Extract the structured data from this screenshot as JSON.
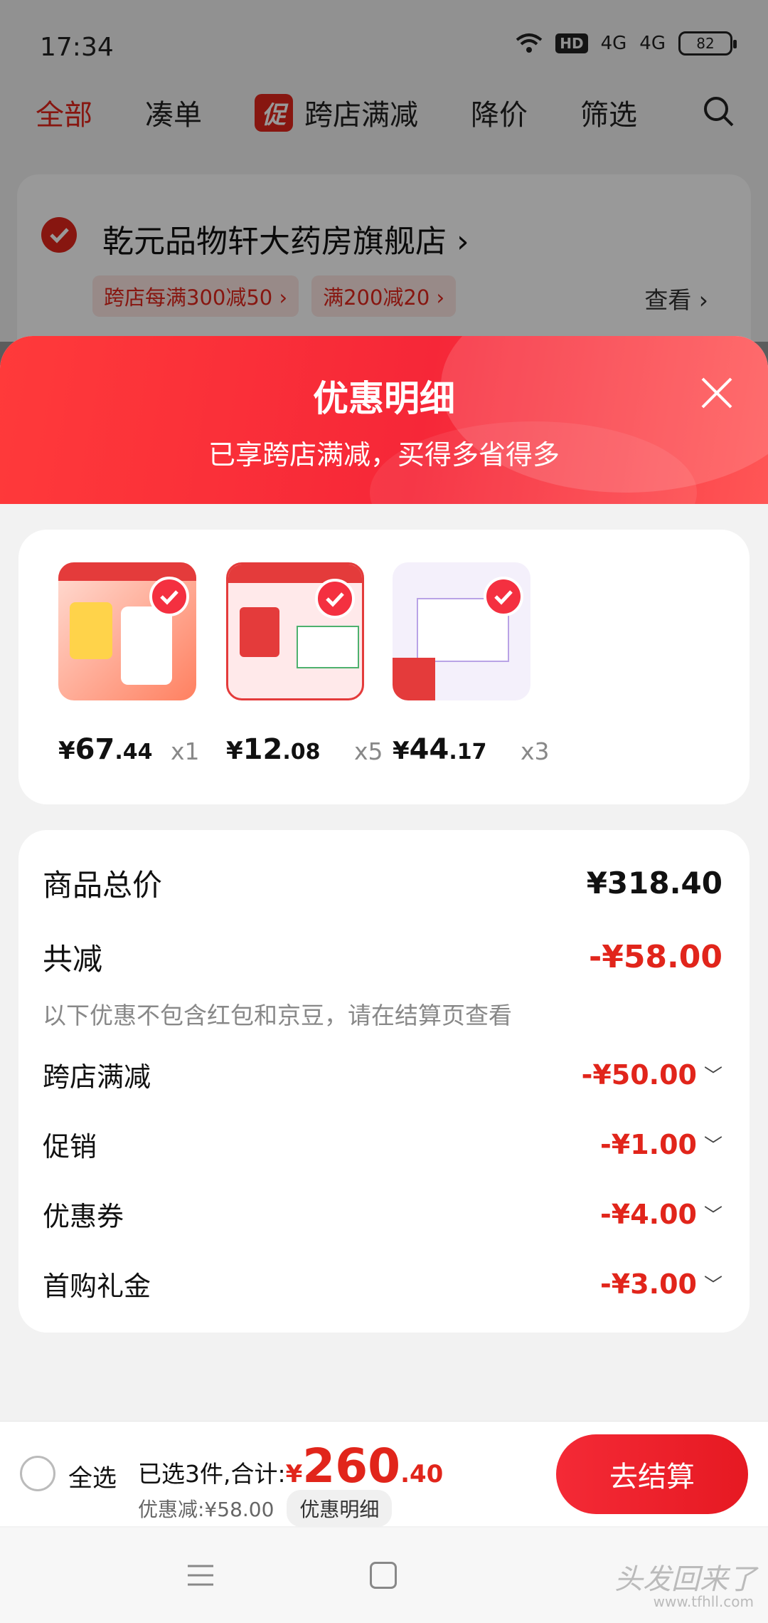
{
  "status_bar": {
    "time": "17:34",
    "network": "HD",
    "signal1": "4G",
    "signal2": "4G",
    "battery": "82"
  },
  "top_tabs": {
    "all": "全部",
    "combine": "凑单",
    "promo_chip": "促",
    "cross_store": "跨店满减",
    "price_drop": "降价",
    "filter": "筛选"
  },
  "shop": {
    "name": "乾元品物轩大药房旗舰店 ›",
    "tags": [
      "跨店每满300减50 ›",
      "满200减20 ›"
    ],
    "view": "查看 ›"
  },
  "modal": {
    "title": "优惠明细",
    "subtitle": "已享跨店满减，买得多省得多",
    "items": [
      {
        "yen": "¥",
        "int": "67",
        "dec": ".44",
        "qty": "x1"
      },
      {
        "yen": "¥",
        "int": "12",
        "dec": ".08",
        "qty": "x5"
      },
      {
        "yen": "¥",
        "int": "44",
        "dec": ".17",
        "qty": "x3"
      }
    ],
    "total_label": "商品总价",
    "total_value": "¥318.40",
    "reduce_label": "共减",
    "reduce_value": "-¥58.00",
    "note": "以下优惠不包含红包和京豆，请在结算页查看",
    "breakdown": [
      {
        "label": "跨店满减",
        "value": "-¥50.00"
      },
      {
        "label": "促销",
        "value": "-¥1.00"
      },
      {
        "label": "优惠券",
        "value": "-¥4.00"
      },
      {
        "label": "首购礼金",
        "value": "-¥3.00"
      }
    ]
  },
  "bottom": {
    "select_all": "全选",
    "selected_text": "已选3件,合计:",
    "yen": "¥",
    "total_int": "260",
    "total_dec": ".40",
    "discount_text": "优惠减:¥58.00",
    "detail_btn": "优惠明细",
    "checkout": "去结算"
  },
  "watermark": {
    "text": "头发回来了",
    "url": "www.tfhll.com"
  },
  "colors": {
    "accent": "#e1251b",
    "sheet_gradient_start": "#ff3a3a",
    "sheet_gradient_end": "#f62738"
  }
}
